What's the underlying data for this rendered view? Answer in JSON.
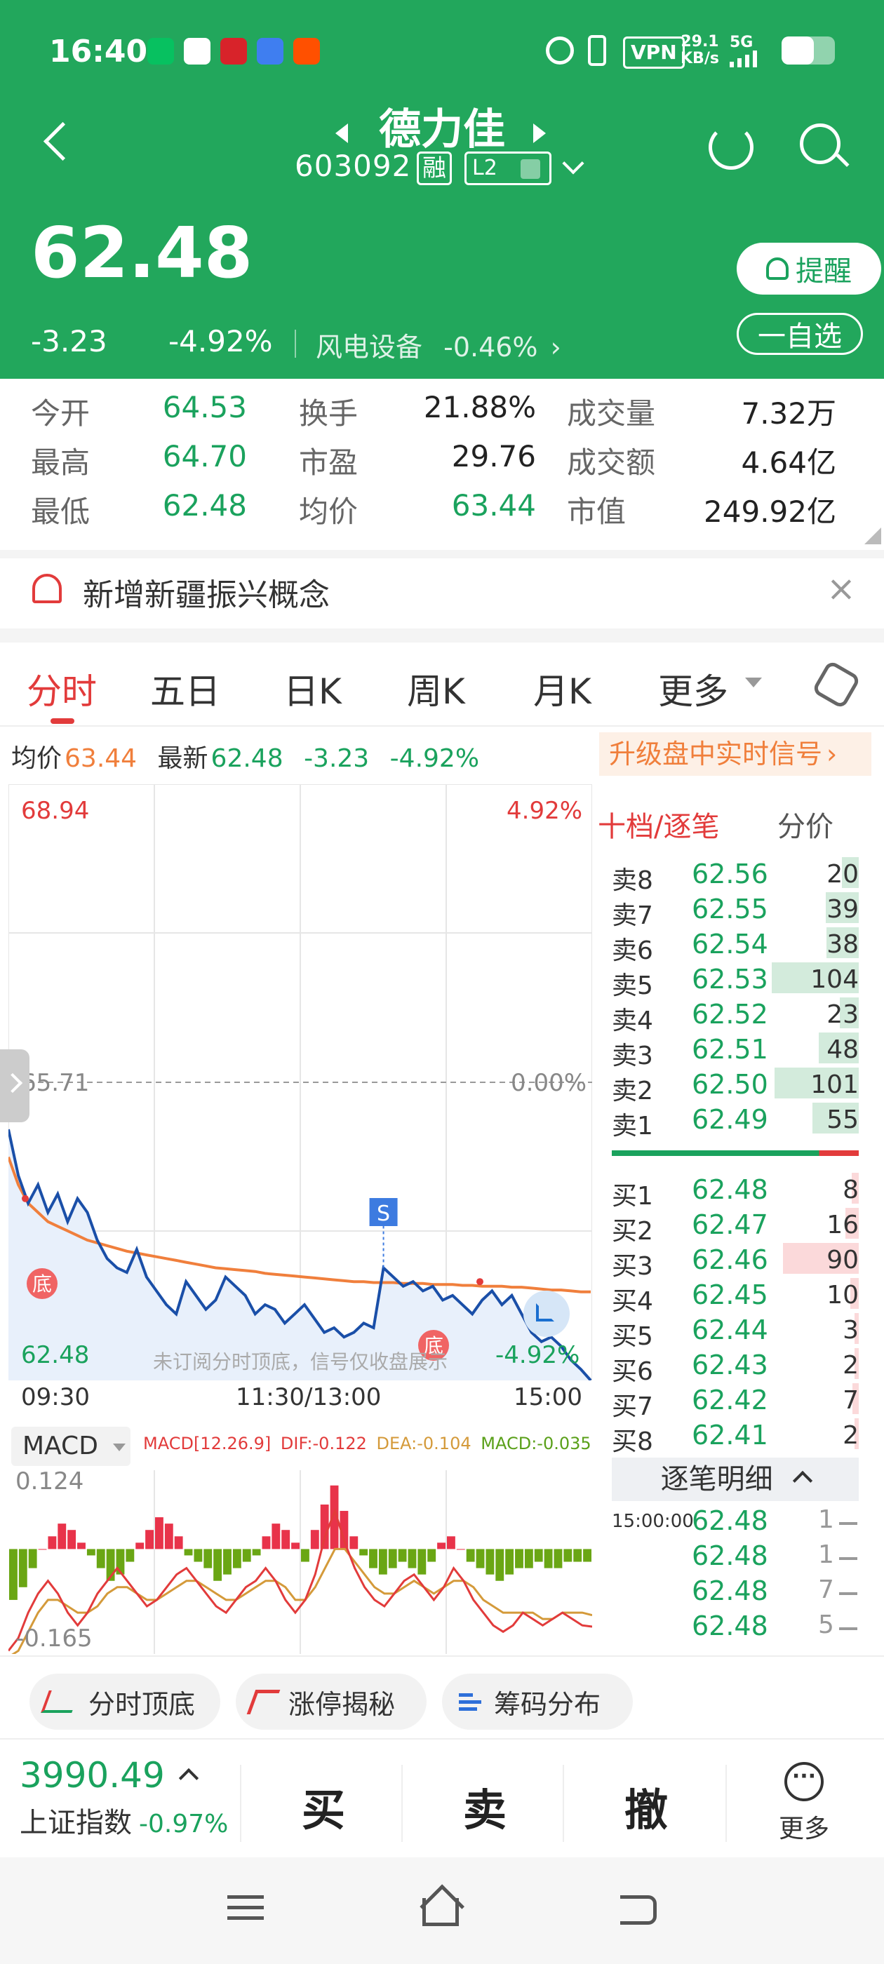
{
  "status_bar": {
    "time": "16:40",
    "vpn": "VPN",
    "net_speed_value": "29.1",
    "net_speed_unit": "KB/s",
    "signal": "5G"
  },
  "stock": {
    "name": "德力佳",
    "code": "603092",
    "badge_margin": "融",
    "badge_level": "L2",
    "price": "62.48",
    "change": "-3.23",
    "change_pct": "-4.92%",
    "sector": "风电设备",
    "sector_change": "-0.46%",
    "remind_label": "提醒",
    "watch_label": "一自选"
  },
  "stats": [
    {
      "label": "今开",
      "value": "64.53",
      "color": "green"
    },
    {
      "label": "换手",
      "value": "21.88%",
      "color": "dark"
    },
    {
      "label": "成交量",
      "value": "7.32万",
      "color": "dark"
    },
    {
      "label": "最高",
      "value": "64.70",
      "color": "green"
    },
    {
      "label": "市盈",
      "value": "29.76",
      "color": "dark"
    },
    {
      "label": "成交额",
      "value": "4.64亿",
      "color": "dark"
    },
    {
      "label": "最低",
      "value": "62.48",
      "color": "green"
    },
    {
      "label": "均价",
      "value": "63.44",
      "color": "green"
    },
    {
      "label": "市值",
      "value": "249.92亿",
      "color": "dark"
    }
  ],
  "notice": {
    "text": "新增新疆振兴概念"
  },
  "tabs": [
    "分时",
    "五日",
    "日K",
    "周K",
    "月K",
    "更多"
  ],
  "info_line": {
    "avg_label": "均价",
    "avg_value": "63.44",
    "latest_label": "最新",
    "latest_value": "62.48",
    "change": "-3.23",
    "change_pct": "-4.92%",
    "upgrade_text": "升级盘中实时信号"
  },
  "intraday": {
    "max_price": "68.94",
    "max_pct": "4.92%",
    "mid_price": "65.71",
    "mid_pct": "0.00%",
    "min_price": "62.48",
    "min_pct": "-4.92%",
    "time_labels": [
      "09:30",
      "11:30/13:00",
      "15:00"
    ],
    "watermark": "未订阅分时顶底，信号仅收盘展示",
    "marker_bottom": "底",
    "marker_sell": "S",
    "price_points": [
      65.2,
      64.7,
      64.4,
      64.6,
      64.3,
      64.5,
      64.2,
      64.45,
      64.3,
      64.0,
      63.8,
      63.7,
      63.65,
      63.9,
      63.6,
      63.45,
      63.3,
      63.2,
      63.55,
      63.4,
      63.25,
      63.35,
      63.6,
      63.5,
      63.4,
      63.2,
      63.3,
      63.25,
      63.1,
      63.2,
      63.3,
      63.15,
      63.0,
      63.05,
      62.95,
      63.0,
      63.1,
      63.05,
      63.7,
      63.6,
      63.5,
      63.55,
      63.45,
      63.5,
      63.35,
      63.4,
      63.3,
      63.2,
      63.35,
      63.45,
      63.3,
      63.4,
      63.2,
      63.0,
      62.9,
      62.95,
      62.85,
      62.7,
      62.6,
      62.48
    ],
    "avg_points": [
      64.9,
      64.6,
      64.4,
      64.3,
      64.2,
      64.15,
      64.1,
      64.05,
      64.0,
      63.97,
      63.94,
      63.91,
      63.88,
      63.86,
      63.84,
      63.82,
      63.8,
      63.78,
      63.76,
      63.74,
      63.72,
      63.7,
      63.69,
      63.68,
      63.67,
      63.66,
      63.64,
      63.63,
      63.62,
      63.61,
      63.6,
      63.59,
      63.58,
      63.57,
      63.56,
      63.55,
      63.55,
      63.54,
      63.54,
      63.54,
      63.53,
      63.53,
      63.53,
      63.52,
      63.52,
      63.52,
      63.51,
      63.51,
      63.5,
      63.5,
      63.5,
      63.49,
      63.49,
      63.48,
      63.47,
      63.46,
      63.46,
      63.45,
      63.44,
      63.44
    ],
    "y_range": [
      62.48,
      68.94
    ]
  },
  "macd": {
    "label": "MACD",
    "params": "MACD[12.26.9]",
    "dif": "DIF:-0.122",
    "dea": "DEA:-0.104",
    "macd": "MACD:-0.035",
    "top": "0.124",
    "bottom": "-0.165",
    "bars": [
      -0.08,
      -0.06,
      -0.03,
      0.0,
      0.02,
      0.04,
      0.03,
      0.01,
      -0.01,
      -0.03,
      -0.05,
      -0.04,
      -0.02,
      0.01,
      0.03,
      0.05,
      0.04,
      0.02,
      -0.01,
      -0.02,
      -0.03,
      -0.05,
      -0.04,
      -0.03,
      -0.02,
      -0.01,
      0.02,
      0.04,
      0.03,
      0.01,
      -0.02,
      0.03,
      0.07,
      0.1,
      0.06,
      0.02,
      -0.01,
      -0.03,
      -0.04,
      -0.03,
      -0.02,
      -0.03,
      -0.04,
      -0.02,
      0.01,
      0.02,
      0.0,
      -0.02,
      -0.03,
      -0.04,
      -0.05,
      -0.04,
      -0.03,
      -0.03,
      -0.02,
      -0.03,
      -0.03,
      -0.02,
      -0.02,
      -0.02
    ],
    "dif_points": [
      -0.16,
      -0.14,
      -0.1,
      -0.07,
      -0.05,
      -0.07,
      -0.1,
      -0.12,
      -0.1,
      -0.07,
      -0.05,
      -0.03,
      -0.05,
      -0.07,
      -0.09,
      -0.08,
      -0.06,
      -0.04,
      -0.03,
      -0.05,
      -0.07,
      -0.09,
      -0.1,
      -0.08,
      -0.06,
      -0.05,
      -0.03,
      -0.05,
      -0.08,
      -0.1,
      -0.08,
      -0.04,
      0.02,
      0.06,
      0.01,
      -0.03,
      -0.06,
      -0.08,
      -0.09,
      -0.07,
      -0.05,
      -0.04,
      -0.06,
      -0.08,
      -0.06,
      -0.03,
      -0.05,
      -0.08,
      -0.1,
      -0.12,
      -0.13,
      -0.12,
      -0.1,
      -0.11,
      -0.12,
      -0.11,
      -0.1,
      -0.11,
      -0.12,
      -0.122
    ],
    "dea_points": [
      -0.17,
      -0.16,
      -0.13,
      -0.1,
      -0.08,
      -0.08,
      -0.09,
      -0.1,
      -0.1,
      -0.09,
      -0.07,
      -0.06,
      -0.06,
      -0.07,
      -0.08,
      -0.08,
      -0.07,
      -0.06,
      -0.05,
      -0.05,
      -0.06,
      -0.07,
      -0.08,
      -0.08,
      -0.07,
      -0.06,
      -0.05,
      -0.05,
      -0.06,
      -0.08,
      -0.08,
      -0.06,
      -0.03,
      0.0,
      0.0,
      -0.02,
      -0.04,
      -0.06,
      -0.07,
      -0.07,
      -0.06,
      -0.05,
      -0.06,
      -0.07,
      -0.06,
      -0.05,
      -0.05,
      -0.06,
      -0.08,
      -0.09,
      -0.1,
      -0.1,
      -0.1,
      -0.1,
      -0.11,
      -0.11,
      -0.1,
      -0.1,
      -0.1,
      -0.104
    ],
    "y_range": [
      -0.165,
      0.124
    ]
  },
  "orderbook": {
    "title": "十档/逐笔",
    "sub": "分价",
    "asks": [
      {
        "label": "卖8",
        "price": "62.56",
        "vol": "20",
        "fill": 0.19
      },
      {
        "label": "卖7",
        "price": "62.55",
        "vol": "39",
        "fill": 0.38
      },
      {
        "label": "卖6",
        "price": "62.54",
        "vol": "38",
        "fill": 0.37
      },
      {
        "label": "卖5",
        "price": "62.53",
        "vol": "104",
        "fill": 1.0
      },
      {
        "label": "卖4",
        "price": "62.52",
        "vol": "23",
        "fill": 0.22
      },
      {
        "label": "卖3",
        "price": "62.51",
        "vol": "48",
        "fill": 0.46
      },
      {
        "label": "卖2",
        "price": "62.50",
        "vol": "101",
        "fill": 0.97
      },
      {
        "label": "卖1",
        "price": "62.49",
        "vol": "55",
        "fill": 0.53
      }
    ],
    "bids": [
      {
        "label": "买1",
        "price": "62.48",
        "vol": "8",
        "fill": 0.08
      },
      {
        "label": "买2",
        "price": "62.47",
        "vol": "16",
        "fill": 0.15
      },
      {
        "label": "买3",
        "price": "62.46",
        "vol": "90",
        "fill": 0.87
      },
      {
        "label": "买4",
        "price": "62.45",
        "vol": "10",
        "fill": 0.1
      },
      {
        "label": "买5",
        "price": "62.44",
        "vol": "3",
        "fill": 0.03
      },
      {
        "label": "买6",
        "price": "62.43",
        "vol": "2",
        "fill": 0.02
      },
      {
        "label": "买7",
        "price": "62.42",
        "vol": "7",
        "fill": 0.07
      },
      {
        "label": "买8",
        "price": "62.41",
        "vol": "2",
        "fill": 0.02
      }
    ],
    "ticks_title": "逐笔明细",
    "ticks": [
      {
        "time": "15:00:00",
        "price": "62.48",
        "vol": "1"
      },
      {
        "time": "",
        "price": "62.48",
        "vol": "1"
      },
      {
        "time": "",
        "price": "62.48",
        "vol": "7"
      },
      {
        "time": "",
        "price": "62.48",
        "vol": "5"
      }
    ]
  },
  "chips": [
    "分时顶底",
    "涨停揭秘",
    "筹码分布"
  ],
  "bottom_bar": {
    "index_value": "3990.49",
    "index_name": "上证指数",
    "index_change": "-0.97%",
    "buy": "买",
    "sell": "卖",
    "cancel": "撤",
    "more": "更多"
  },
  "colors": {
    "header_green": "#22a75c",
    "price_green": "#1aa25d",
    "price_red": "#e23b3b",
    "avg_orange": "#f07f3c",
    "line_blue": "#1a4fa8"
  }
}
